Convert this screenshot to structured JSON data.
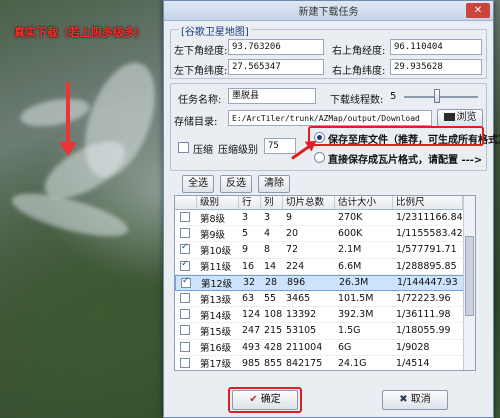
{
  "map": {
    "note": "真实下载（若上限多级多）"
  },
  "dialog": {
    "title": "新建下载任务",
    "close_label": "✕",
    "source_group": "[谷歌卫星地图]",
    "coords": {
      "ll_lon_label": "左下角经度:",
      "ll_lon": "93.763206",
      "ur_lon_label": "右上角经度:",
      "ur_lon": "96.110404",
      "ll_lat_label": "左下角纬度:",
      "ll_lat": "27.565347",
      "ur_lat_label": "右上角纬度:",
      "ur_lat": "29.935628"
    },
    "task_name_label": "任务名称:",
    "task_name": "墨脱县",
    "threads_label": "下载线程数:",
    "threads": "5",
    "threads_level": 0.45,
    "save_dir_label": "存储目录:",
    "save_dir": "E:/ArcTiler/trunk/AZMap/output/Download",
    "browse_label": "浏览",
    "compress_label": "压缩",
    "compress_level_label": "压缩级别",
    "compress_level": "75",
    "option_db": "保存至库文件（推荐，可生成所有格式）",
    "option_tiles": "直接保存成瓦片格式，请配置 --->",
    "select_all": "全选",
    "invert": "反选",
    "clear": "清除",
    "table": {
      "headers": [
        "",
        "级别",
        "行",
        "列",
        "切片总数",
        "估计大小",
        "比例尺"
      ],
      "rows": [
        {
          "checked": false,
          "level": "第8级",
          "rows": "3",
          "cols": "3",
          "tiles": "9",
          "size": "270K",
          "scale": "1/2311166.84"
        },
        {
          "checked": false,
          "level": "第9级",
          "rows": "5",
          "cols": "4",
          "tiles": "20",
          "size": "600K",
          "scale": "1/1155583.42"
        },
        {
          "checked": true,
          "level": "第10级",
          "rows": "9",
          "cols": "8",
          "tiles": "72",
          "size": "2.1M",
          "scale": "1/577791.71"
        },
        {
          "checked": true,
          "level": "第11级",
          "rows": "16",
          "cols": "14",
          "tiles": "224",
          "size": "6.6M",
          "scale": "1/288895.85"
        },
        {
          "checked": true,
          "level": "第12级",
          "rows": "32",
          "cols": "28",
          "tiles": "896",
          "size": "26.3M",
          "scale": "1/144447.93",
          "selected": true
        },
        {
          "checked": false,
          "level": "第13级",
          "rows": "63",
          "cols": "55",
          "tiles": "3465",
          "size": "101.5M",
          "scale": "1/72223.96"
        },
        {
          "checked": false,
          "level": "第14级",
          "rows": "124",
          "cols": "108",
          "tiles": "13392",
          "size": "392.3M",
          "scale": "1/36111.98"
        },
        {
          "checked": false,
          "level": "第15级",
          "rows": "247",
          "cols": "215",
          "tiles": "53105",
          "size": "1.5G",
          "scale": "1/18055.99"
        },
        {
          "checked": false,
          "level": "第16级",
          "rows": "493",
          "cols": "428",
          "tiles": "211004",
          "size": "6G",
          "scale": "1/9028"
        },
        {
          "checked": false,
          "level": "第17级",
          "rows": "985",
          "cols": "855",
          "tiles": "842175",
          "size": "24.1G",
          "scale": "1/4514"
        }
      ]
    },
    "ok_label": "确定",
    "cancel_label": "取消"
  },
  "colors": {
    "accent": "#e02020",
    "dialog_bg": "#eaeef3",
    "selected_row": "#cde3fb"
  }
}
